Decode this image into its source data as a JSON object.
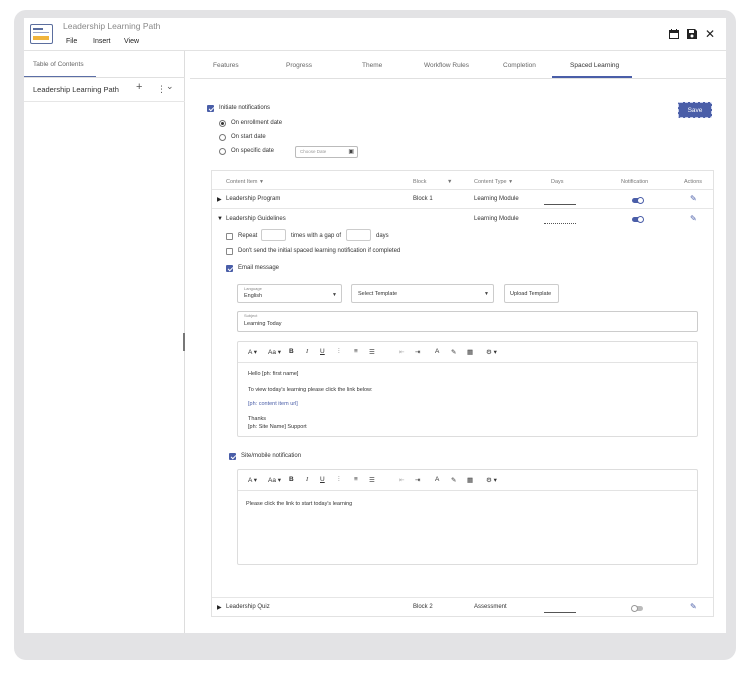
{
  "app": {
    "title": "Leadership Learning Path",
    "menu": [
      "File",
      "Insert",
      "View"
    ],
    "icons": [
      "calendar-icon",
      "save-icon",
      "close-icon"
    ]
  },
  "sidebar": {
    "heading": "Table of Contents",
    "item": "Leadership Learning Path",
    "add": "+",
    "more": "⋮",
    "expand": "⌄"
  },
  "tabs": [
    "Features",
    "Progress",
    "Theme",
    "Workflow Rules",
    "Completion",
    "Spaced Learning"
  ],
  "active_tab": "Spaced Learning",
  "notifications": {
    "initiate_label": "Initiate notifications",
    "initiate_checked": true,
    "options": [
      "On enrollment date",
      "On start date",
      "On specific date"
    ],
    "selected": "On enrollment date",
    "date_placeholder": "Choose Date",
    "save_label": "Save"
  },
  "table": {
    "headers": [
      "Content Item",
      "Block",
      "Content Type",
      "Days",
      "Notification",
      "Actions"
    ],
    "rows": [
      {
        "name": "Leadership Program",
        "block": "Block 1",
        "type": "Learning Module",
        "notification": true
      },
      {
        "name": "Leadership Guidelines",
        "block": "",
        "type": "Learning Module",
        "notification": true
      },
      {
        "name": "Leadership Quiz",
        "block": "Block 2",
        "type": "Assessment",
        "notification": false
      }
    ]
  },
  "details": {
    "repeat_label": "Repeat",
    "times_label": "times with a gap of",
    "days_label": "days",
    "dont_send_label": "Don't send the initial spaced learning notification if completed",
    "email_label": "Email message",
    "email_checked": true,
    "language_label": "Language",
    "language_value": "English",
    "template_value": "Select Template",
    "upload_label": "Upload Template",
    "subject_label": "Subject",
    "subject_value": "Learning Today",
    "email_body": {
      "line1": "Hello [ph: first name]",
      "line2": "To view today's learning please click the link below:",
      "line3": "[ph: content item url]",
      "line4": "Thanks",
      "line5": "[ph: Site Name] Support"
    },
    "site_label": "Site/mobile notification",
    "site_checked": true,
    "site_body": "Please click the link to start today's learning"
  },
  "toolbar": {
    "font": "A ▾",
    "size": "Aa ▾",
    "bold": "B",
    "italic": "I",
    "underline": "U",
    "align_left": "⫶",
    "align_center": "≡",
    "list": "☰",
    "indent_out": "⇤",
    "indent_in": "⇥",
    "color": "A",
    "brush": "✎",
    "table": "▦",
    "settings": "⚙ ▾"
  },
  "colors": {
    "accent": "#4a5ea8"
  }
}
